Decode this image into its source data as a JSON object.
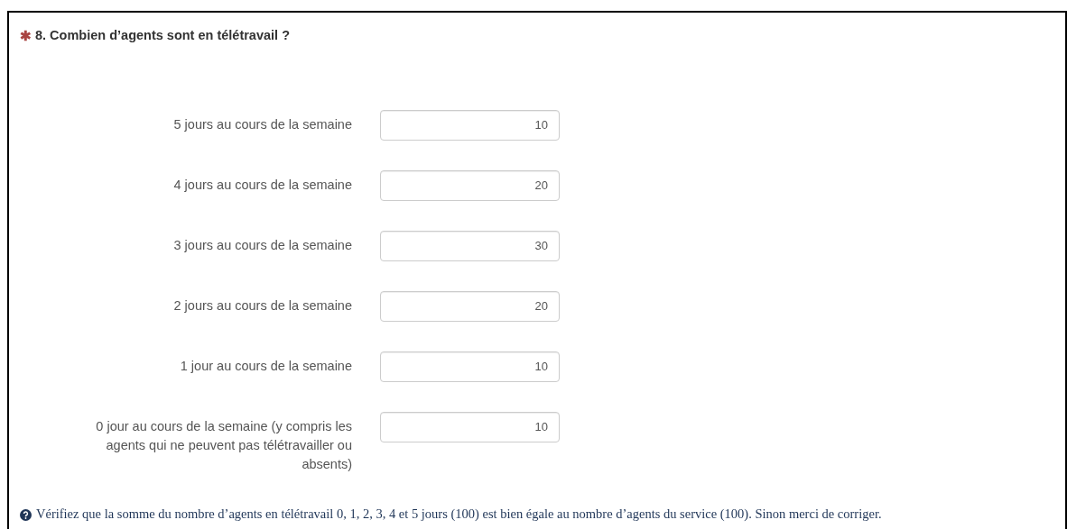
{
  "question": {
    "required_mark": "✱",
    "title": "8. Combien d’agents sont en télétravail ?"
  },
  "rows": [
    {
      "label": "5 jours au cours de la semaine",
      "value": "10"
    },
    {
      "label": "4 jours au cours de la semaine",
      "value": "20"
    },
    {
      "label": "3 jours au cours de la semaine",
      "value": "30"
    },
    {
      "label": "2 jours au cours de la semaine",
      "value": "20"
    },
    {
      "label": "1 jour au cours de la semaine",
      "value": "10"
    },
    {
      "label": "0 jour au cours de la semaine (y compris les agents qui ne peuvent pas télétravailler ou absents)",
      "value": "10"
    }
  ],
  "hint": "Vérifiez que la somme du nombre d’agents en télétravail 0, 1, 2, 3, 4 et 5 jours (100) est bien égale au nombre d’agents du service (100). Sinon merci de corriger."
}
